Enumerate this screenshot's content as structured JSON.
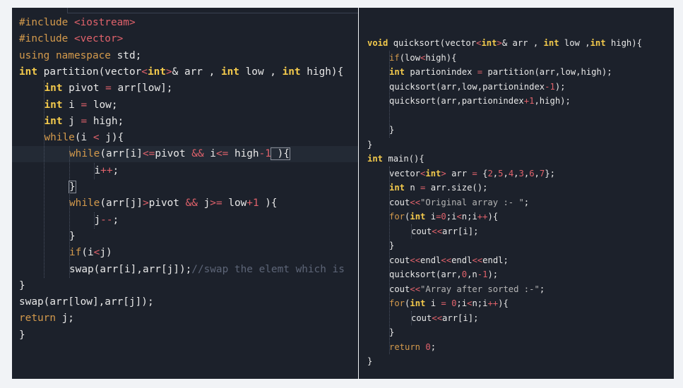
{
  "left_editor": {
    "lines": [
      [
        "#include ",
        "<iostream>"
      ],
      [
        "#include ",
        "<vector>"
      ],
      [
        "using namespace ",
        "std;"
      ],
      [
        "int",
        " partition(vector",
        "<",
        "int",
        ">",
        "& arr , ",
        "int",
        " low , ",
        "int",
        " high){"
      ],
      [
        "int",
        " pivot ",
        "=",
        " arr[low];"
      ],
      [
        "int",
        " i ",
        "=",
        " low;"
      ],
      [
        "int",
        " j ",
        "=",
        " high;"
      ],
      [
        "while",
        "(i ",
        "<",
        " j){"
      ],
      [
        "while",
        "(arr[i]",
        "<=",
        "pivot ",
        "&&",
        " i",
        "<=",
        " high",
        "-1",
        " ){"
      ],
      [
        "i",
        "++",
        ";"
      ],
      [
        "}"
      ],
      [
        "while",
        "(arr[j]",
        ">",
        "pivot ",
        "&&",
        " j",
        ">=",
        " low",
        "+1",
        " ){"
      ],
      [
        "j",
        "--",
        ";"
      ],
      [
        "}"
      ],
      [
        "if",
        "(i",
        "<",
        "j)"
      ],
      [
        "swap(arr[i],arr[j]);",
        "//swap the elemt which is"
      ],
      [
        "}"
      ],
      [
        "swap(arr[low],arr[j]);"
      ],
      [
        "return",
        " j;"
      ],
      [
        "}"
      ]
    ]
  },
  "right_editor": {
    "lines": [
      [
        "void",
        " quicksort(vector",
        "<",
        "int",
        ">",
        "& arr , ",
        "int",
        " low ,",
        "int",
        " high){"
      ],
      [
        "if",
        "(low",
        "<",
        "high){"
      ],
      [
        "int",
        " partionindex ",
        "=",
        " partition(arr,low,high);"
      ],
      [
        "quicksort(arr,low,partionindex",
        "-1",
        ");"
      ],
      [
        "quicksort(arr,partionindex",
        "+1",
        ",high);"
      ],
      [
        ""
      ],
      [
        "}"
      ],
      [
        "}"
      ],
      [
        "int",
        " main(){"
      ],
      [
        "vector",
        "<",
        "int",
        ">",
        " arr ",
        "=",
        " {",
        "2",
        ",",
        "5",
        ",",
        "4",
        ",",
        "3",
        ",",
        "6",
        ",",
        "7",
        "};"
      ],
      [
        "int",
        " n ",
        "=",
        " arr.size();"
      ],
      [
        "cout",
        "<<",
        "\"Original array :- \"",
        ";"
      ],
      [
        "for",
        "(",
        "int",
        " i",
        "=",
        "0",
        ";i",
        "<",
        "n;i",
        "++",
        "){"
      ],
      [
        "cout",
        "<<",
        "arr[i];"
      ],
      [
        "}"
      ],
      [
        "cout",
        "<<",
        "endl",
        "<<",
        "endl",
        "<<",
        "endl;"
      ],
      [
        "quicksort(arr,",
        "0",
        ",n",
        "-1",
        ");"
      ],
      [
        "cout",
        "<<",
        "\"Array after sorted :-\"",
        ";"
      ],
      [
        "for",
        "(",
        "int",
        " i ",
        "=",
        " ",
        "0",
        ";i",
        "<",
        "n;i",
        "++",
        "){"
      ],
      [
        "cout",
        "<<",
        "arr[i];"
      ],
      [
        "}"
      ],
      [
        "return",
        " ",
        "0",
        ";"
      ],
      [
        "}"
      ]
    ]
  },
  "colors": {
    "background": "#f1f3f6",
    "editor_bg": "#1c212b",
    "keyword": "#f2c94c",
    "control": "#d49a4c",
    "operator": "#e0626b",
    "string": "#b5b5b5",
    "comment": "#5d6577",
    "text": "#e8e8e8"
  }
}
